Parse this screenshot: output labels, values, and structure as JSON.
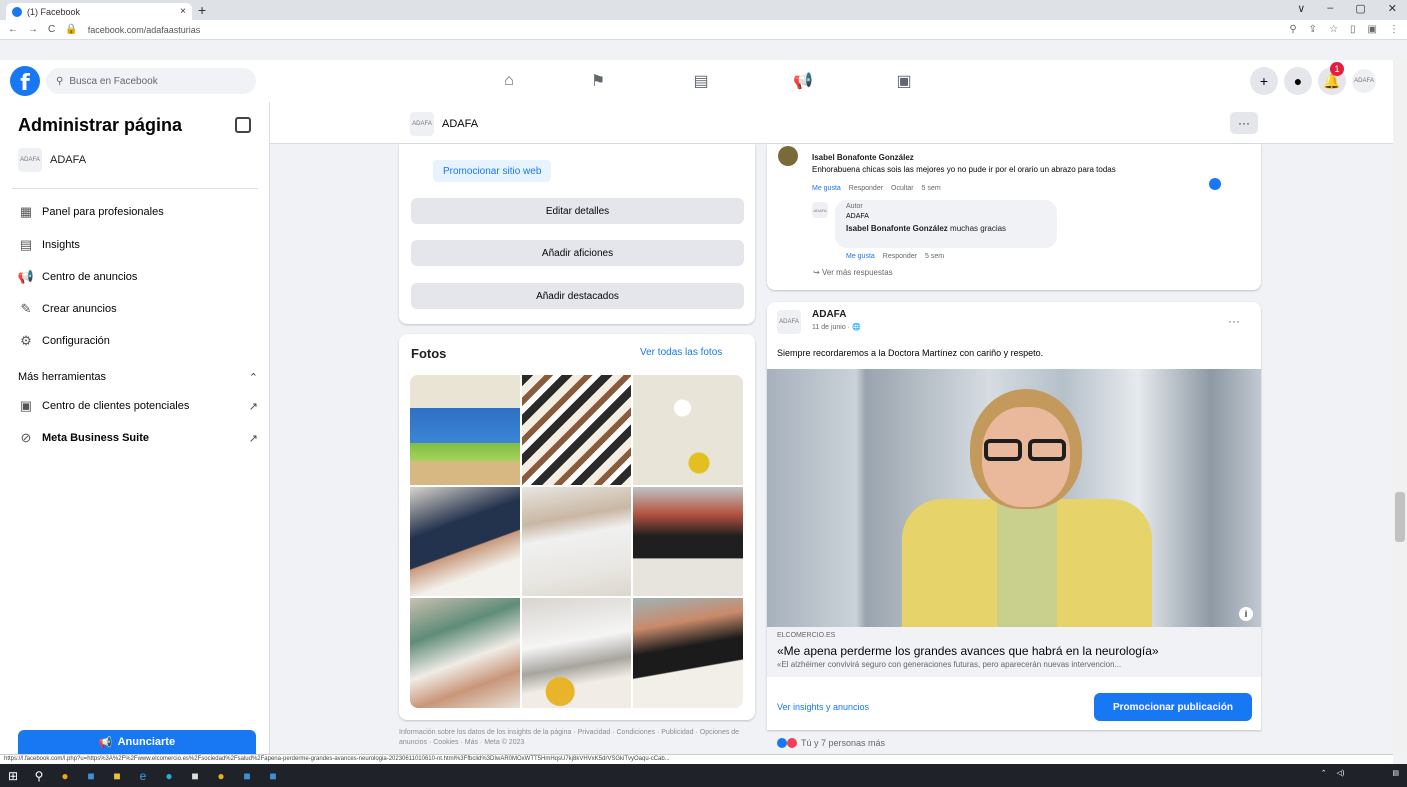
{
  "browser": {
    "tab_title": "(1) Facebook",
    "tab_close": "×",
    "new_tab": "+",
    "url": "facebook.com/adafaasturias",
    "window_controls": [
      "∨",
      "–",
      "▢",
      "✕"
    ],
    "nav": [
      "←",
      "→",
      "C"
    ]
  },
  "fb_nav": {
    "logo": "f",
    "search_placeholder": "Busca en Facebook",
    "icons": [
      "home-icon",
      "flag-icon",
      "pages-icon",
      "megaphone-icon",
      "watch-icon"
    ],
    "notification_count": "1"
  },
  "sidebar": {
    "title": "Administrar página",
    "page_name": "ADAFA",
    "items": [
      {
        "label": "Panel para profesionales",
        "icon": "▦"
      },
      {
        "label": "Insights",
        "icon": "▤"
      },
      {
        "label": "Centro de anuncios",
        "icon": "📢"
      },
      {
        "label": "Crear anuncios",
        "icon": "✎"
      },
      {
        "label": "Configuración",
        "icon": "⚙"
      }
    ],
    "more_tools": "Más herramientas",
    "tools": [
      {
        "label": "Centro de clientes potenciales",
        "icon": "▣"
      },
      {
        "label": "Meta Business Suite",
        "icon": "⊘"
      }
    ],
    "advertise_label": "Anunciarte"
  },
  "page_header": {
    "name": "ADAFA",
    "more": "···"
  },
  "about": {
    "promote_web": "Promocionar sitio web",
    "edit_details": "Editar detalles",
    "add_hobbies": "Añadir aficiones",
    "add_featured": "Añadir destacados"
  },
  "photos": {
    "title": "Fotos",
    "see_all": "Ver todas las fotos"
  },
  "footer_info": "Información sobre los datos de los insights de la página · Privacidad · Condiciones · Publicidad · Opciones de anuncios · Cookies · Más · Meta © 2023",
  "comments": {
    "c1_name": "Isabel Bonafonte González",
    "c1_text": "Enhorabuena chicas sois las mejores yo no pude ir por el orario un abrazo para todas",
    "c1_actions": {
      "like": "Me gusta",
      "reply": "Responder",
      "hide": "Ocultar",
      "time": "5 sem"
    },
    "c2_author": "Autor",
    "c2_page": "ADAFA",
    "c2_mention": "Isabel Bonafonte González",
    "c2_text": "muchas gracias",
    "c2_actions": {
      "like": "Me gusta",
      "reply": "Responder",
      "time": "5 sem"
    },
    "more_replies": "Ver más respuestas"
  },
  "post": {
    "author": "ADAFA",
    "date": "11 de junio · 🌐",
    "more": "···",
    "text": "Siempre recordaremos a la Doctora Martínez con cariño y respeto.",
    "link_source": "ELCOMERCIO.ES",
    "link_title": "«Me apena perderme los grandes avances que habrá en la neurología»",
    "link_desc": "«El alzhéimer convivirá seguro con generaciones futuras, pero aparecerán nuevas intervencion...",
    "insights": "Ver insights y anuncios",
    "promote": "Promocionar publicación",
    "reactions": "Tú y 7 personas más"
  },
  "status_url": "https://l.facebook.com/l.php?u=https%3A%2F%2Fwww.elcomercio.es%2Fsociedad%2Fsalud%2Fapena-perderme-grandes-avances-neurologia-20230611010610-nt.html%3Ffbclid%3DIwAR0MOxWTT5HmHqsU7kj8kVHVxK5drVSGkiTvyOaqu-cCab..."
}
